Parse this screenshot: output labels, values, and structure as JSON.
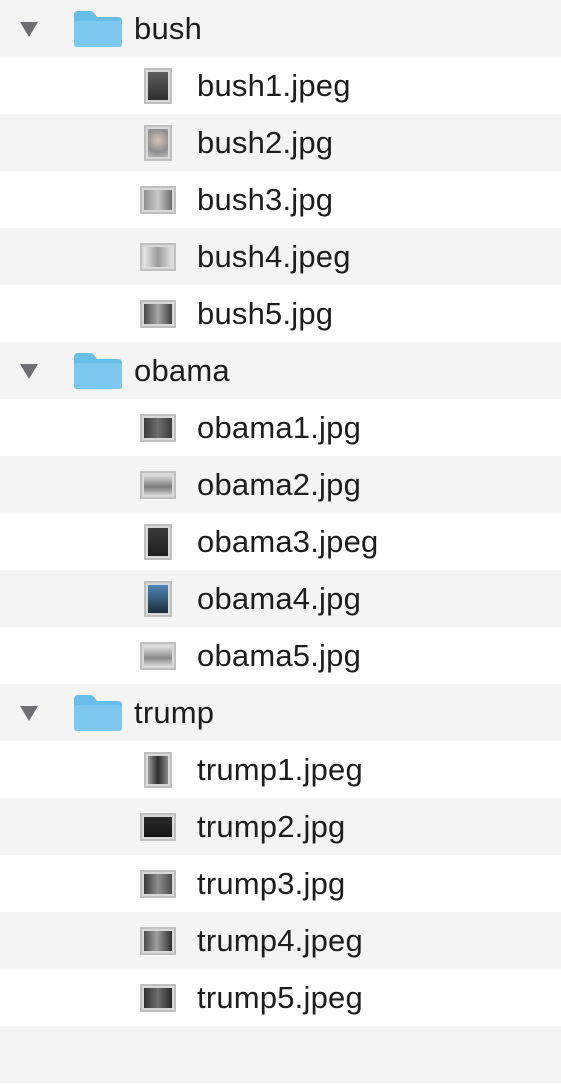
{
  "accent_color": "#6bbde9",
  "folders": [
    {
      "name": "bush",
      "icon": "folder-icon",
      "expanded": true,
      "files": [
        {
          "name": "bush1.jpeg",
          "thumb": "portrait"
        },
        {
          "name": "bush2.jpg",
          "thumb": "portrait"
        },
        {
          "name": "bush3.jpg",
          "thumb": "landscape"
        },
        {
          "name": "bush4.jpeg",
          "thumb": "landscape"
        },
        {
          "name": "bush5.jpg",
          "thumb": "landscape"
        }
      ]
    },
    {
      "name": "obama",
      "icon": "folder-icon",
      "expanded": true,
      "files": [
        {
          "name": "obama1.jpg",
          "thumb": "landscape"
        },
        {
          "name": "obama2.jpg",
          "thumb": "landscape"
        },
        {
          "name": "obama3.jpeg",
          "thumb": "portrait"
        },
        {
          "name": "obama4.jpg",
          "thumb": "portrait"
        },
        {
          "name": "obama5.jpg",
          "thumb": "landscape"
        }
      ]
    },
    {
      "name": "trump",
      "icon": "folder-icon",
      "expanded": true,
      "files": [
        {
          "name": "trump1.jpeg",
          "thumb": "portrait"
        },
        {
          "name": "trump2.jpg",
          "thumb": "landscape"
        },
        {
          "name": "trump3.jpg",
          "thumb": "landscape"
        },
        {
          "name": "trump4.jpeg",
          "thumb": "landscape"
        },
        {
          "name": "trump5.jpeg",
          "thumb": "landscape"
        }
      ]
    }
  ]
}
